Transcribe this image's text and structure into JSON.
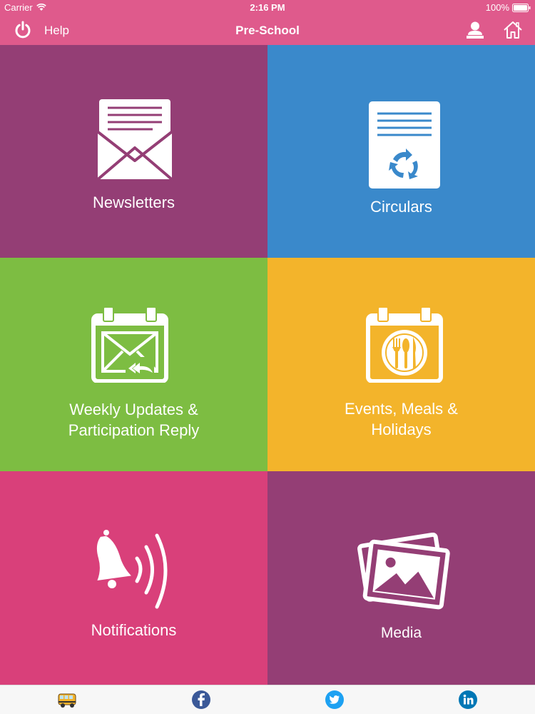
{
  "status_bar": {
    "carrier": "Carrier",
    "time": "2:16 PM",
    "battery": "100%"
  },
  "nav": {
    "power_icon": "power-icon",
    "help_label": "Help",
    "title": "Pre-School",
    "profile_icon": "user-icon",
    "home_icon": "home-icon"
  },
  "tiles": [
    {
      "label": "Newsletters",
      "icon": "envelope-newsletter-icon",
      "color": "#943e75"
    },
    {
      "label": "Circulars",
      "icon": "circular-document-icon",
      "color": "#3a89cb"
    },
    {
      "label": "Weekly Updates &\nParticipation Reply",
      "icon": "calendar-mail-reply-icon",
      "color": "#7dbd42"
    },
    {
      "label": "Events, Meals &\nHolidays",
      "icon": "calendar-meal-icon",
      "color": "#f3b42b"
    },
    {
      "label": "Notifications",
      "icon": "bell-icon",
      "color": "#d9407a"
    },
    {
      "label": "Media",
      "icon": "photos-icon",
      "color": "#943e75"
    }
  ],
  "tab_bar": {
    "items": [
      {
        "icon": "school-bus-icon"
      },
      {
        "icon": "facebook-icon",
        "color": "#3b5998"
      },
      {
        "icon": "twitter-icon",
        "color": "#1da1f2"
      },
      {
        "icon": "linkedin-icon",
        "color": "#0077b5"
      }
    ]
  },
  "colors": {
    "header": "#df5a8c"
  }
}
